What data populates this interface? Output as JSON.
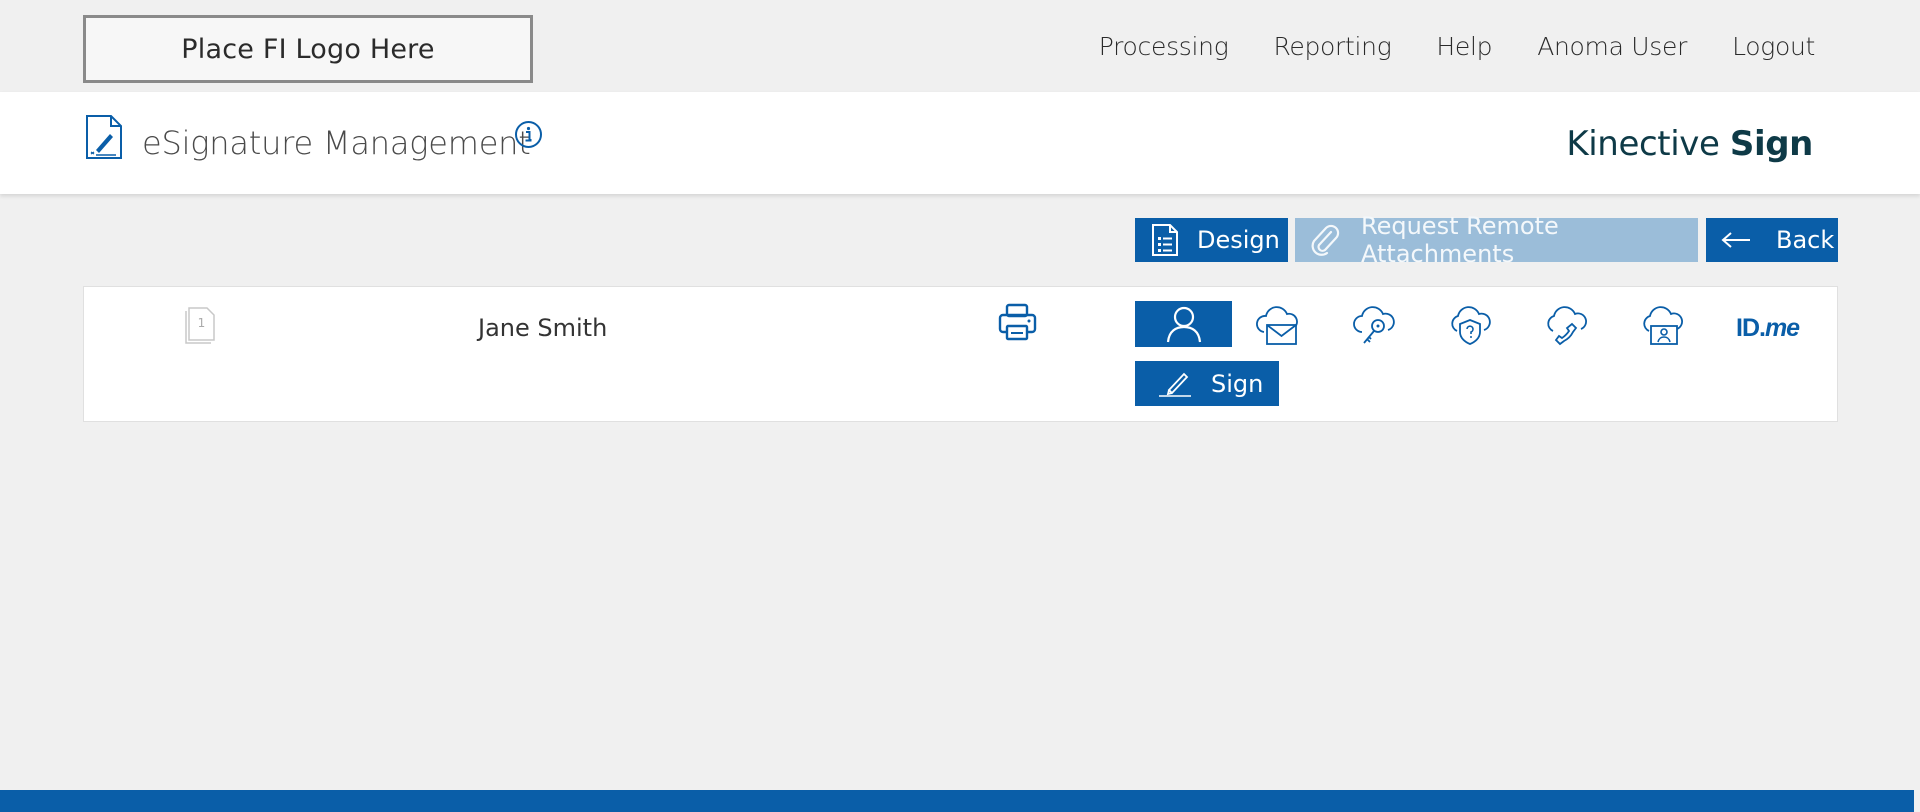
{
  "header": {
    "logo_placeholder": "Place FI Logo Here",
    "nav": [
      "Processing",
      "Reporting",
      "Help",
      "Anoma User",
      "Logout"
    ]
  },
  "titlebar": {
    "title": "eSignature Management",
    "brand_light": "Kinective",
    "brand_bold": "Sign"
  },
  "actions": {
    "design": "Design",
    "request_attachments": "Request Remote Attachments",
    "back": "Back"
  },
  "signer": {
    "document_number": "1",
    "name": "Jane Smith",
    "auth_methods": [
      "in-person",
      "email",
      "passcode",
      "knowledge-based",
      "phone",
      "id-verification",
      "ID.me"
    ],
    "idme_prefix": "ID.",
    "idme_suffix": "me",
    "sign_label": "Sign"
  },
  "colors": {
    "primary": "#0a5ea8",
    "disabled": "#9bbdd9",
    "brand_text": "#0e3a47"
  }
}
